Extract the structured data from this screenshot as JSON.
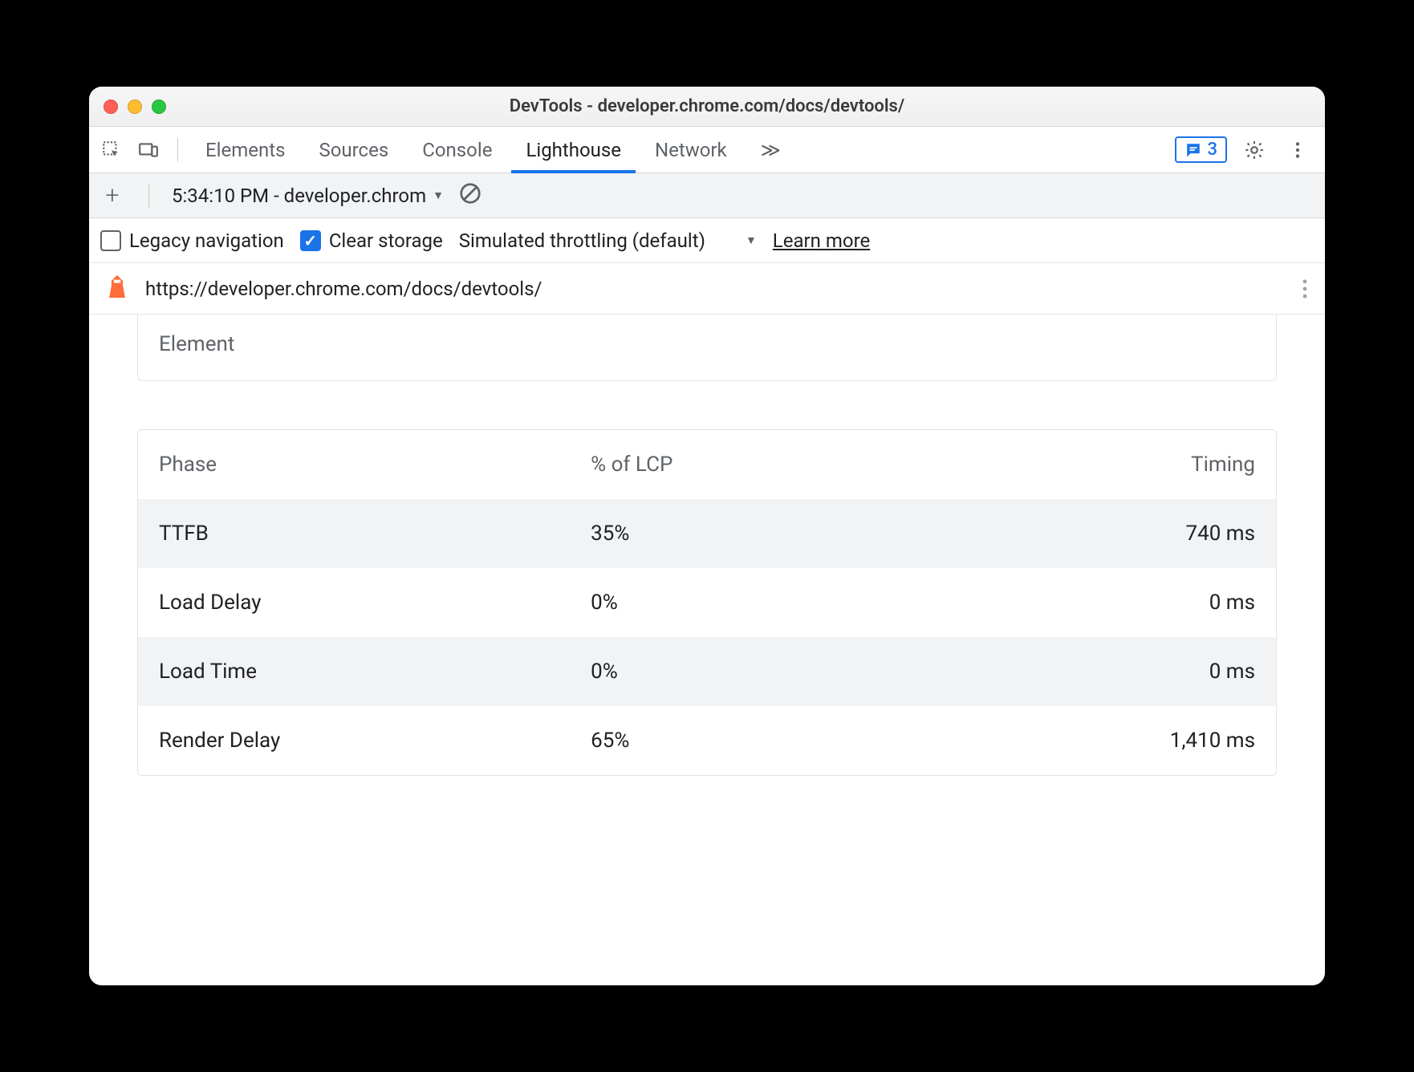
{
  "window_title": "DevTools - developer.chrome.com/docs/devtools/",
  "tabs": {
    "items": [
      "Elements",
      "Sources",
      "Console",
      "Lighthouse",
      "Network"
    ],
    "active_index": 3,
    "overflow_glyph": "≫",
    "badge_count": "3"
  },
  "subbar": {
    "report_label": "5:34:10 PM - developer.chrom"
  },
  "options": {
    "legacy_label": "Legacy navigation",
    "legacy_checked": false,
    "clear_label": "Clear storage",
    "clear_checked": true,
    "throttle_label": "Simulated throttling (default)",
    "learn_more": "Learn more"
  },
  "url": "https://developer.chrome.com/docs/devtools/",
  "element_card_label": "Element",
  "table": {
    "headers": {
      "phase": "Phase",
      "pct": "% of LCP",
      "timing": "Timing"
    },
    "rows": [
      {
        "phase": "TTFB",
        "pct": "35%",
        "timing": "740 ms"
      },
      {
        "phase": "Load Delay",
        "pct": "0%",
        "timing": "0 ms"
      },
      {
        "phase": "Load Time",
        "pct": "0%",
        "timing": "0 ms"
      },
      {
        "phase": "Render Delay",
        "pct": "65%",
        "timing": "1,410 ms"
      }
    ]
  }
}
